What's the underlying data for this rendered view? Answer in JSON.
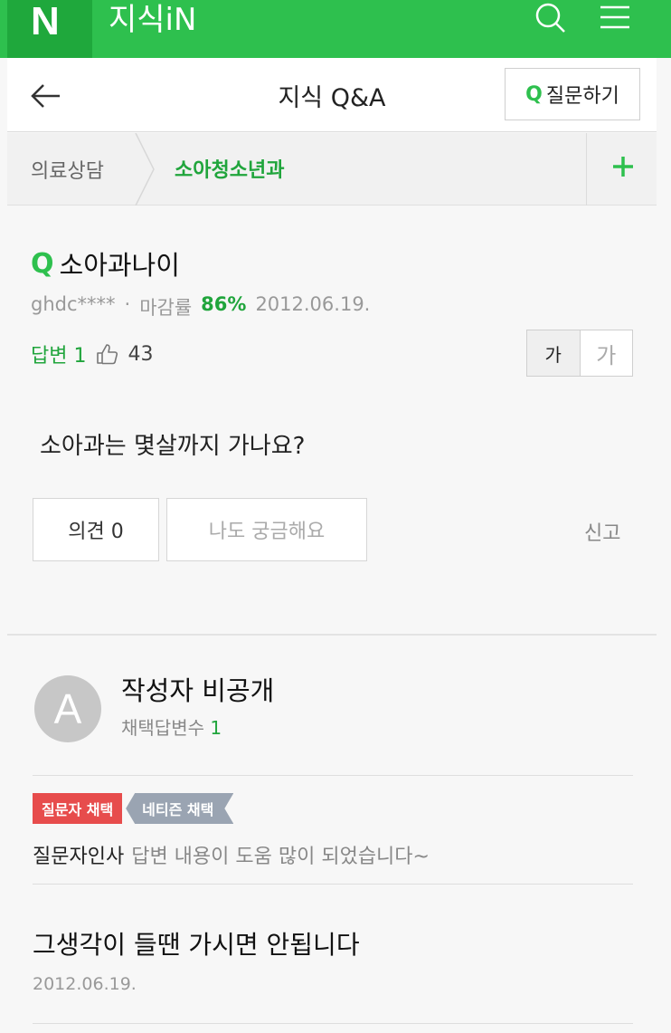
{
  "header": {
    "logo": "N",
    "brand": "지식iN",
    "colors": {
      "brand_green": "#2ec04e",
      "logo_box": "#1fa83c"
    }
  },
  "titlebar": {
    "title": "지식 Q&A",
    "ask_q": "Q",
    "ask_label": "질문하기"
  },
  "category": {
    "parent": "의료상담",
    "current": "소아청소년과",
    "add_icon": "plus-icon"
  },
  "question": {
    "q_mark": "Q",
    "title": "소아과나이",
    "author": "ghdc****",
    "dot": "·",
    "close_rate_label": "마감률",
    "close_rate": "86%",
    "date": "2012.06.19.",
    "answer_count": "답변 1",
    "likes": "43",
    "font_small": "가",
    "font_large": "가",
    "body": "소아과는 몇살까지 가나요?",
    "opinion_btn": "의견 0",
    "curious_btn": "나도 궁금해요",
    "report": "신고"
  },
  "answer": {
    "avatar_letter": "A",
    "author": "작성자 비공개",
    "picked_label": "채택답변수",
    "picked_count": "1",
    "badge_asker": "질문자 채택",
    "badge_netizen": "네티즌 채택",
    "thanks_label": "질문자인사",
    "thanks_msg": "답변 내용이 도움 많이 되었습니다~",
    "text": "그생각이 들땐 가시면 안됩니다",
    "date": "2012.06.19."
  }
}
